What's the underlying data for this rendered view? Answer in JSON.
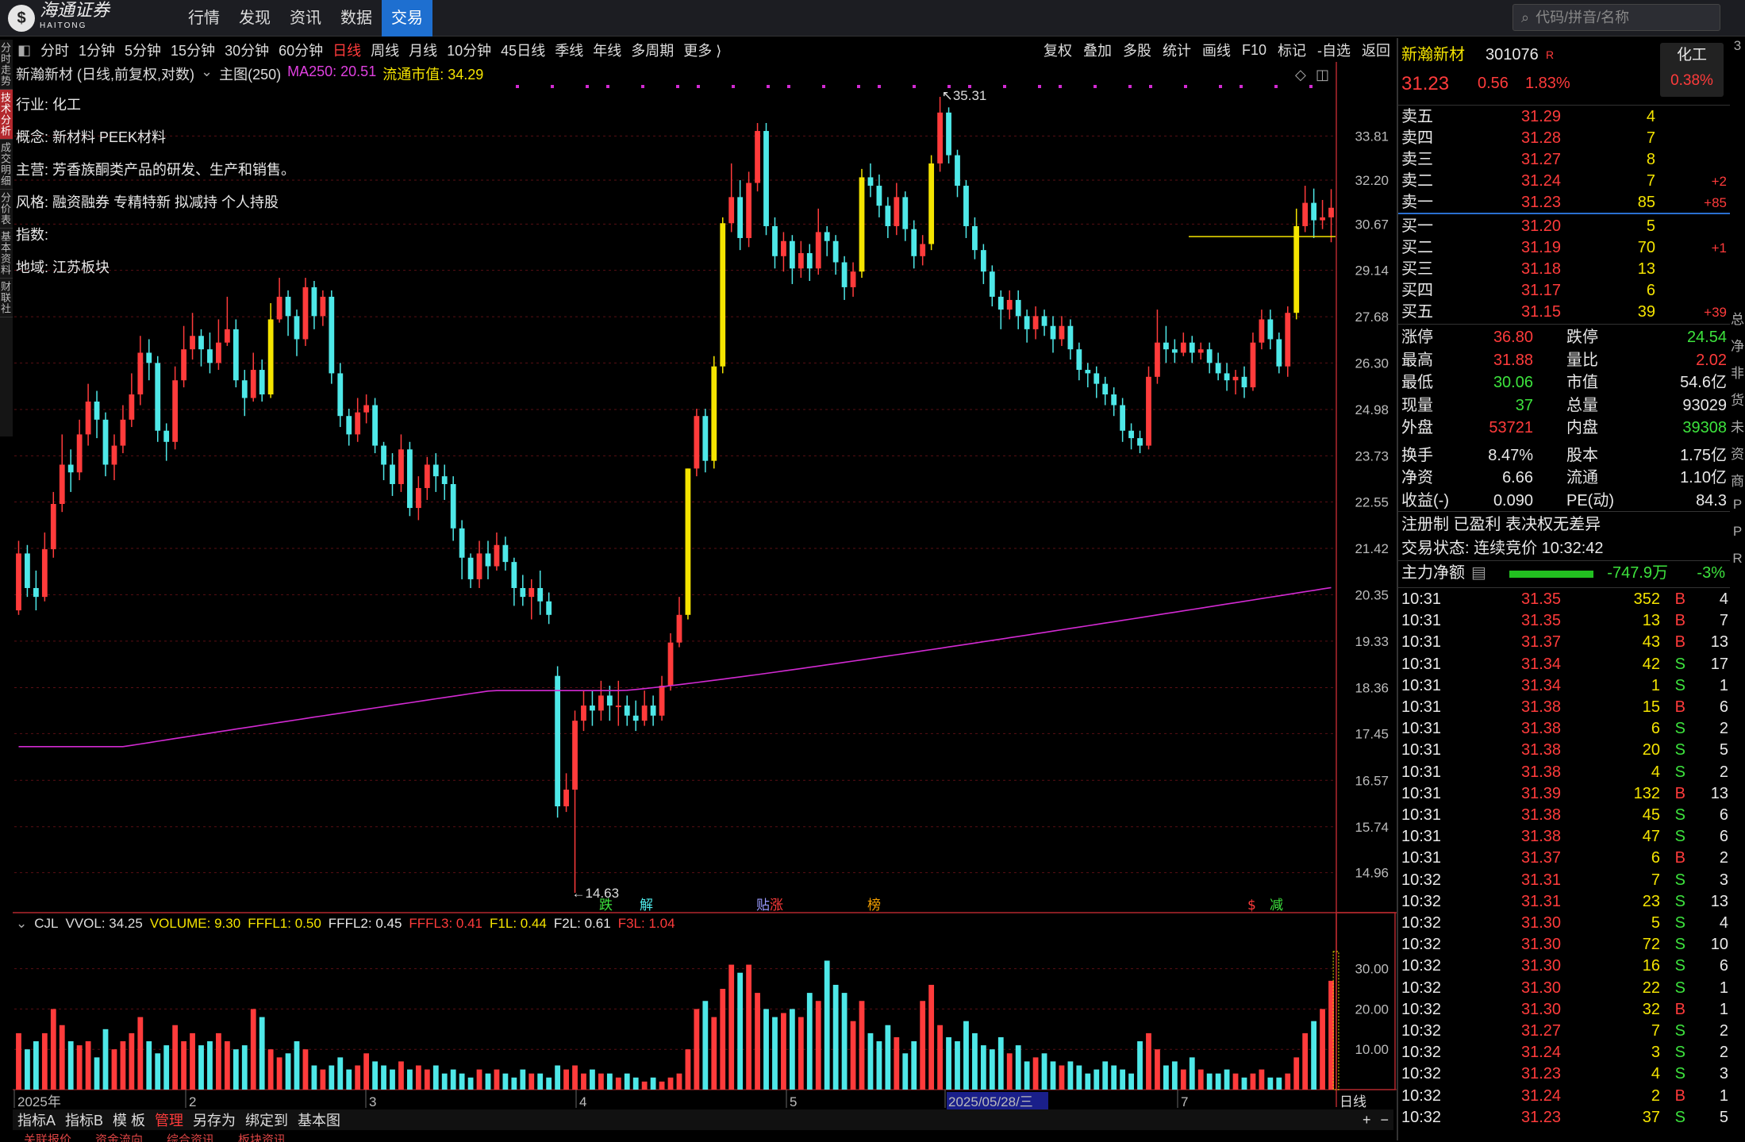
{
  "top": {
    "logo_text": "海通证券",
    "logo_en": "HAITONG",
    "nav": [
      "行情",
      "发现",
      "资讯",
      "数据",
      "交易"
    ],
    "search_placeholder": "代码/拼音/名称"
  },
  "left_tabs": [
    "分时走势",
    "技术分析",
    "成交明细",
    "分价表",
    "基本资料",
    "财联社"
  ],
  "periods": [
    "分时",
    "1分钟",
    "5分钟",
    "15分钟",
    "30分钟",
    "60分钟",
    "日线",
    "周线",
    "月线",
    "10分钟",
    "45日线",
    "季线",
    "年线",
    "多周期",
    "更多 ⟩"
  ],
  "tools": [
    "复权",
    "叠加",
    "多股",
    "统计",
    "画线",
    "F10",
    "标记",
    "-自选",
    "返回"
  ],
  "chart_header": {
    "title": "新瀚新材 (日线,前复权,对数)",
    "main": "主图(250)",
    "ma": "MA250: 20.51",
    "cap": "流通市值: 34.29"
  },
  "info": [
    {
      "k": "行业:",
      "v": "化工"
    },
    {
      "k": "概念:",
      "v": "新材料 PEEK材料"
    },
    {
      "k": "主营:",
      "v": "芳香族酮类产品的研发、生产和销售。"
    },
    {
      "k": "风格:",
      "v": "融资融券 专精特新 拟减持 个人持股"
    },
    {
      "k": "指数:",
      "v": ""
    },
    {
      "k": "地域:",
      "v": "江苏板块"
    }
  ],
  "chart_data": {
    "type": "candlestick",
    "title": "新瀚新材 (日线,前复权,对数)",
    "y_ticks": [
      33.81,
      32.2,
      30.67,
      29.14,
      27.68,
      26.3,
      24.98,
      23.73,
      22.55,
      21.42,
      20.35,
      19.33,
      18.36,
      17.45,
      16.57,
      15.74,
      14.96
    ],
    "x_labels": [
      "2025年",
      "2",
      "3",
      "4",
      "5",
      "2025/05/28/三",
      "7"
    ],
    "annotations": {
      "high": "35.31",
      "low": "14.63"
    },
    "event_tags": [
      "跌",
      "解",
      "贴",
      "涨",
      "榜",
      "$",
      "减"
    ],
    "ma250": {
      "name": "MA250",
      "last": 20.51
    },
    "candles": [
      [
        20.0,
        21.3,
        21.6,
        19.9
      ],
      [
        21.3,
        20.5,
        21.5,
        20.3
      ],
      [
        20.5,
        20.3,
        20.9,
        20.0
      ],
      [
        20.3,
        21.4,
        21.8,
        20.2
      ],
      [
        21.4,
        22.5,
        22.8,
        21.2
      ],
      [
        22.5,
        23.5,
        24.3,
        22.3
      ],
      [
        23.5,
        23.3,
        23.9,
        22.8
      ],
      [
        23.3,
        24.3,
        24.7,
        23.1
      ],
      [
        24.3,
        25.2,
        25.7,
        24.0
      ],
      [
        25.2,
        24.7,
        25.5,
        24.2
      ],
      [
        24.7,
        23.5,
        24.9,
        23.2
      ],
      [
        23.5,
        24.0,
        24.3,
        23.1
      ],
      [
        24.0,
        24.7,
        25.1,
        23.8
      ],
      [
        24.7,
        25.4,
        26.0,
        24.5
      ],
      [
        25.4,
        26.6,
        27.1,
        25.1
      ],
      [
        26.6,
        26.3,
        27.0,
        25.8
      ],
      [
        26.3,
        24.4,
        26.5,
        24.1
      ],
      [
        24.4,
        24.1,
        24.6,
        23.6
      ],
      [
        24.1,
        25.8,
        26.2,
        23.9
      ],
      [
        25.8,
        26.7,
        27.4,
        25.6
      ],
      [
        26.7,
        27.1,
        27.8,
        26.4
      ],
      [
        27.1,
        26.7,
        27.3,
        26.2
      ],
      [
        26.7,
        26.3,
        27.2,
        26.0
      ],
      [
        26.3,
        26.9,
        27.6,
        26.1
      ],
      [
        26.9,
        27.3,
        28.3,
        26.8
      ],
      [
        27.3,
        25.8,
        27.6,
        25.6
      ],
      [
        25.8,
        25.3,
        26.1,
        24.8
      ],
      [
        25.3,
        26.1,
        26.6,
        25.2
      ],
      [
        26.1,
        25.4,
        26.4,
        25.2
      ],
      [
        25.4,
        27.6,
        28.1,
        25.3
      ],
      [
        27.6,
        28.3,
        28.9,
        27.5
      ],
      [
        28.3,
        27.7,
        28.5,
        27.1
      ],
      [
        27.7,
        27.0,
        27.9,
        26.5
      ],
      [
        27.0,
        28.6,
        28.9,
        26.8
      ],
      [
        28.6,
        27.7,
        28.8,
        27.3
      ],
      [
        27.7,
        28.3,
        28.5,
        27.4
      ],
      [
        28.3,
        26.0,
        28.5,
        25.7
      ],
      [
        26.0,
        24.8,
        26.3,
        24.5
      ],
      [
        24.8,
        24.3,
        25.0,
        24.0
      ],
      [
        24.3,
        24.9,
        25.3,
        24.1
      ],
      [
        24.9,
        25.1,
        25.4,
        24.6
      ],
      [
        25.1,
        24.0,
        25.3,
        23.8
      ],
      [
        24.0,
        23.5,
        24.1,
        23.1
      ],
      [
        23.5,
        23.0,
        23.8,
        22.7
      ],
      [
        23.0,
        23.9,
        24.3,
        22.8
      ],
      [
        23.9,
        22.4,
        24.1,
        22.2
      ],
      [
        22.4,
        22.9,
        23.2,
        22.1
      ],
      [
        22.9,
        23.5,
        23.7,
        22.6
      ],
      [
        23.5,
        23.2,
        23.8,
        22.8
      ],
      [
        23.2,
        23.0,
        23.5,
        22.6
      ],
      [
        23.0,
        21.9,
        23.2,
        21.6
      ],
      [
        21.9,
        21.2,
        22.1,
        20.7
      ],
      [
        21.2,
        20.7,
        21.3,
        20.5
      ],
      [
        20.7,
        21.3,
        21.6,
        20.5
      ],
      [
        21.3,
        21.0,
        21.6,
        20.7
      ],
      [
        21.0,
        21.5,
        21.8,
        20.9
      ],
      [
        21.5,
        21.1,
        21.7,
        20.9
      ],
      [
        21.1,
        20.5,
        21.2,
        20.1
      ],
      [
        20.5,
        20.3,
        20.8,
        20.1
      ],
      [
        20.3,
        20.5,
        20.7,
        19.8
      ],
      [
        20.5,
        20.2,
        20.9,
        19.9
      ],
      [
        20.2,
        19.9,
        20.4,
        19.7
      ],
      [
        18.6,
        16.1,
        18.8,
        15.9
      ],
      [
        16.1,
        16.4,
        16.7,
        16.0
      ],
      [
        16.4,
        17.7,
        17.9,
        14.63
      ],
      [
        17.7,
        18.0,
        18.3,
        17.5
      ],
      [
        18.0,
        17.9,
        18.3,
        17.6
      ],
      [
        17.9,
        18.2,
        18.5,
        17.7
      ],
      [
        18.2,
        18.0,
        18.4,
        17.7
      ],
      [
        18.0,
        18.0,
        18.5,
        17.6
      ],
      [
        18.0,
        17.8,
        18.2,
        17.6
      ],
      [
        17.8,
        17.7,
        18.1,
        17.5
      ],
      [
        17.7,
        18.0,
        18.3,
        17.6
      ],
      [
        18.0,
        17.8,
        18.2,
        17.6
      ],
      [
        17.8,
        18.4,
        18.6,
        17.7
      ],
      [
        18.4,
        19.3,
        19.5,
        18.3
      ],
      [
        19.3,
        19.9,
        20.3,
        19.2
      ],
      [
        19.9,
        23.4,
        23.4,
        19.8
      ],
      [
        23.4,
        24.8,
        25.0,
        23.2
      ],
      [
        24.8,
        23.6,
        25.0,
        23.3
      ],
      [
        23.6,
        26.2,
        26.5,
        23.4
      ],
      [
        26.2,
        30.7,
        30.9,
        26.0
      ],
      [
        30.7,
        31.6,
        32.8,
        30.4
      ],
      [
        31.6,
        30.2,
        32.2,
        29.8
      ],
      [
        30.2,
        32.1,
        32.5,
        29.9
      ],
      [
        32.1,
        34.0,
        34.3,
        31.8
      ],
      [
        34.0,
        30.6,
        34.3,
        30.3
      ],
      [
        30.6,
        29.6,
        30.9,
        29.2
      ],
      [
        29.6,
        30.1,
        30.4,
        29.1
      ],
      [
        30.1,
        29.2,
        30.3,
        28.7
      ],
      [
        29.2,
        29.7,
        30.1,
        28.9
      ],
      [
        29.7,
        29.2,
        30.0,
        28.8
      ],
      [
        29.2,
        30.4,
        31.2,
        29.0
      ],
      [
        30.4,
        30.1,
        30.6,
        29.6
      ],
      [
        30.1,
        29.4,
        30.3,
        29.0
      ],
      [
        29.4,
        28.6,
        29.6,
        28.2
      ],
      [
        28.6,
        29.1,
        29.4,
        28.3
      ],
      [
        29.1,
        32.3,
        32.6,
        28.9
      ],
      [
        32.3,
        32.0,
        32.8,
        31.6
      ],
      [
        32.0,
        31.3,
        32.4,
        30.9
      ],
      [
        31.3,
        30.6,
        31.6,
        30.2
      ],
      [
        30.6,
        31.6,
        32.1,
        30.3
      ],
      [
        31.6,
        30.5,
        31.8,
        30.1
      ],
      [
        30.5,
        29.6,
        30.8,
        29.2
      ],
      [
        29.6,
        30.0,
        30.3,
        29.3
      ],
      [
        30.0,
        32.8,
        33.1,
        29.8
      ],
      [
        32.8,
        34.7,
        35.31,
        32.5
      ],
      [
        34.7,
        33.1,
        34.9,
        32.8
      ],
      [
        33.1,
        32.0,
        33.3,
        31.6
      ],
      [
        32.0,
        30.6,
        32.2,
        30.2
      ],
      [
        30.6,
        29.8,
        30.9,
        29.5
      ],
      [
        29.8,
        29.1,
        30.0,
        28.7
      ],
      [
        29.1,
        28.3,
        29.3,
        28.0
      ],
      [
        28.3,
        27.9,
        28.5,
        27.3
      ],
      [
        27.9,
        28.2,
        28.5,
        27.6
      ],
      [
        28.2,
        27.7,
        28.5,
        27.3
      ],
      [
        27.7,
        27.3,
        27.9,
        26.9
      ],
      [
        27.3,
        27.7,
        28.0,
        27.0
      ],
      [
        27.7,
        27.4,
        27.9,
        27.1
      ],
      [
        27.4,
        27.0,
        27.7,
        26.6
      ],
      [
        27.0,
        27.4,
        27.7,
        26.8
      ],
      [
        27.4,
        26.7,
        27.6,
        26.4
      ],
      [
        26.7,
        26.1,
        26.9,
        25.8
      ],
      [
        26.1,
        26.0,
        26.3,
        25.6
      ],
      [
        26.0,
        25.7,
        26.2,
        25.3
      ],
      [
        25.7,
        25.4,
        25.9,
        25.1
      ],
      [
        25.4,
        25.1,
        25.6,
        24.8
      ],
      [
        25.1,
        24.4,
        25.3,
        24.1
      ],
      [
        24.4,
        24.2,
        24.6,
        23.9
      ],
      [
        24.2,
        24.0,
        24.4,
        23.8
      ],
      [
        24.0,
        25.9,
        26.2,
        23.9
      ],
      [
        25.9,
        26.9,
        27.9,
        25.7
      ],
      [
        26.9,
        26.7,
        27.4,
        26.3
      ],
      [
        26.7,
        26.6,
        27.0,
        26.3
      ],
      [
        26.6,
        26.9,
        27.2,
        26.5
      ],
      [
        26.9,
        26.6,
        27.1,
        26.3
      ],
      [
        26.6,
        26.7,
        26.9,
        26.4
      ],
      [
        26.7,
        26.3,
        26.9,
        26.0
      ],
      [
        26.3,
        26.0,
        26.6,
        25.8
      ],
      [
        26.0,
        25.8,
        26.3,
        25.5
      ],
      [
        25.8,
        25.9,
        26.1,
        25.4
      ],
      [
        25.9,
        25.6,
        26.2,
        25.3
      ],
      [
        25.6,
        26.9,
        27.2,
        25.5
      ],
      [
        26.9,
        27.6,
        27.9,
        26.7
      ],
      [
        27.6,
        27.0,
        27.9,
        26.7
      ],
      [
        27.0,
        26.2,
        27.2,
        26.0
      ],
      [
        26.2,
        27.8,
        28.0,
        25.9
      ],
      [
        27.8,
        30.6,
        31.2,
        27.6
      ],
      [
        30.6,
        31.4,
        32.0,
        30.4
      ],
      [
        31.4,
        30.8,
        31.9,
        30.2
      ],
      [
        30.8,
        30.9,
        31.5,
        30.5
      ],
      [
        30.9,
        31.23,
        31.88,
        30.06
      ]
    ],
    "volume": {
      "label": "CJL",
      "y_ticks": [
        30.0,
        20.0,
        10.0
      ],
      "values": [
        14,
        10,
        12,
        14,
        20,
        16,
        12,
        11,
        12,
        8,
        15,
        10,
        12,
        14,
        18,
        12,
        9,
        11,
        16,
        12,
        14,
        11,
        12,
        14,
        12,
        10,
        11,
        20,
        18,
        10,
        8,
        9,
        12,
        10,
        6,
        5,
        6,
        8,
        5,
        6,
        9,
        7,
        6,
        5,
        7,
        5,
        6,
        5,
        6,
        4,
        5,
        4,
        3,
        5,
        4,
        5,
        4,
        3,
        5,
        4,
        4,
        3,
        6,
        5,
        6,
        4,
        5,
        4,
        4,
        3,
        4,
        3,
        2,
        3,
        2,
        3,
        4,
        10,
        20,
        22,
        18,
        25,
        31,
        29,
        31,
        24,
        20,
        18,
        19,
        20,
        18,
        24,
        22,
        32,
        26,
        24,
        17,
        22,
        14,
        12,
        16,
        13,
        9,
        12,
        22,
        26,
        16,
        13,
        12,
        17,
        14,
        11,
        10,
        13,
        9,
        11,
        7,
        8,
        9,
        7,
        6,
        7,
        6,
        4,
        5,
        7,
        6,
        5,
        4,
        12,
        14,
        10,
        6,
        7,
        5,
        8,
        5,
        4,
        4,
        5,
        4,
        3,
        4,
        5,
        3,
        3,
        4,
        8,
        14,
        17,
        20,
        27,
        26,
        18,
        10,
        7
      ],
      "series": [
        {
          "name": "VVOL",
          "value": "34.25"
        },
        {
          "name": "VOLUME",
          "value": "9.30"
        },
        {
          "name": "FFFL1",
          "value": "0.50"
        },
        {
          "name": "FFFL2",
          "value": "0.45"
        },
        {
          "name": "FFFL3",
          "value": "0.41"
        },
        {
          "name": "F1L",
          "value": "0.44"
        },
        {
          "name": "F2L",
          "value": "0.61"
        },
        {
          "name": "F3L",
          "value": "1.04"
        }
      ]
    }
  },
  "bottom_tabs": [
    "指标A",
    "指标B",
    "模 板",
    "管理",
    "另存为",
    "绑定到",
    "基本图"
  ],
  "bottom_footer": [
    "关联报价",
    "资金流向",
    "综合资讯",
    "板块资讯"
  ],
  "vol_period_label": "日线",
  "quote": {
    "name": "新瀚新材",
    "code": "301076",
    "tag": "R",
    "sector": "化工",
    "sector_pct": "0.38%",
    "price": "31.23",
    "change": "0.56",
    "pct": "1.83%",
    "asks": [
      {
        "l": "卖五",
        "p": "31.29",
        "v": "4",
        "d": ""
      },
      {
        "l": "卖四",
        "p": "31.28",
        "v": "7",
        "d": ""
      },
      {
        "l": "卖三",
        "p": "31.27",
        "v": "8",
        "d": ""
      },
      {
        "l": "卖二",
        "p": "31.24",
        "v": "7",
        "d": "+2"
      },
      {
        "l": "卖一",
        "p": "31.23",
        "v": "85",
        "d": "+85"
      }
    ],
    "bids": [
      {
        "l": "买一",
        "p": "31.20",
        "v": "5",
        "d": ""
      },
      {
        "l": "买二",
        "p": "31.19",
        "v": "70",
        "d": "+1"
      },
      {
        "l": "买三",
        "p": "31.18",
        "v": "13",
        "d": ""
      },
      {
        "l": "买四",
        "p": "31.17",
        "v": "6",
        "d": ""
      },
      {
        "l": "买五",
        "p": "31.15",
        "v": "39",
        "d": "+39"
      }
    ],
    "stats": [
      [
        "涨停",
        "36.80",
        "跌停",
        "24.54"
      ],
      [
        "最高",
        "31.88",
        "量比",
        "2.02"
      ],
      [
        "最低",
        "30.06",
        "市值",
        "54.6亿"
      ],
      [
        "现量",
        "37",
        "总量",
        "93029"
      ],
      [
        "外盘",
        "53721",
        "内盘",
        "39308"
      ],
      [
        "换手",
        "8.47%",
        "股本",
        "1.75亿"
      ],
      [
        "净资",
        "6.66",
        "流通",
        "1.10亿"
      ],
      [
        "收益(-)",
        "0.090",
        "PE(动)",
        "84.3"
      ]
    ],
    "tags_line": "注册制 已盈利 表决权无差异",
    "trade_state": "交易状态: 连续竞价 10:32:42",
    "main_flow_label": "主力净额",
    "main_flow": "-747.9万",
    "main_flow_pct": "-3%",
    "ticks": [
      [
        "10:31",
        "31.35",
        "352",
        "B",
        "4"
      ],
      [
        "10:31",
        "31.35",
        "13",
        "B",
        "7"
      ],
      [
        "10:31",
        "31.37",
        "43",
        "B",
        "13"
      ],
      [
        "10:31",
        "31.34",
        "42",
        "S",
        "17"
      ],
      [
        "10:31",
        "31.34",
        "1",
        "S",
        "1"
      ],
      [
        "10:31",
        "31.38",
        "15",
        "B",
        "6"
      ],
      [
        "10:31",
        "31.38",
        "6",
        "S",
        "2"
      ],
      [
        "10:31",
        "31.38",
        "20",
        "S",
        "5"
      ],
      [
        "10:31",
        "31.38",
        "4",
        "S",
        "2"
      ],
      [
        "10:31",
        "31.39",
        "132",
        "B",
        "13"
      ],
      [
        "10:31",
        "31.38",
        "45",
        "S",
        "6"
      ],
      [
        "10:31",
        "31.38",
        "47",
        "S",
        "6"
      ],
      [
        "10:31",
        "31.37",
        "6",
        "B",
        "2"
      ],
      [
        "10:32",
        "31.31",
        "7",
        "S",
        "3"
      ],
      [
        "10:32",
        "31.31",
        "23",
        "S",
        "13"
      ],
      [
        "10:32",
        "31.30",
        "5",
        "S",
        "4"
      ],
      [
        "10:32",
        "31.30",
        "72",
        "S",
        "10"
      ],
      [
        "10:32",
        "31.30",
        "16",
        "S",
        "6"
      ],
      [
        "10:32",
        "31.30",
        "22",
        "S",
        "1"
      ],
      [
        "10:32",
        "31.30",
        "32",
        "B",
        "1"
      ],
      [
        "10:32",
        "31.27",
        "7",
        "S",
        "2"
      ],
      [
        "10:32",
        "31.24",
        "3",
        "S",
        "2"
      ],
      [
        "10:32",
        "31.23",
        "4",
        "S",
        "3"
      ],
      [
        "10:32",
        "31.24",
        "2",
        "B",
        "1"
      ],
      [
        "10:32",
        "31.23",
        "37",
        "S",
        "5"
      ]
    ]
  },
  "colors": {
    "up": "#ff3b3b",
    "down": "#4ee8e8",
    "ma": "#d22ad2",
    "grid": "#5a0f14",
    "frame": "#b3282d",
    "highlight": "#f5e400"
  }
}
